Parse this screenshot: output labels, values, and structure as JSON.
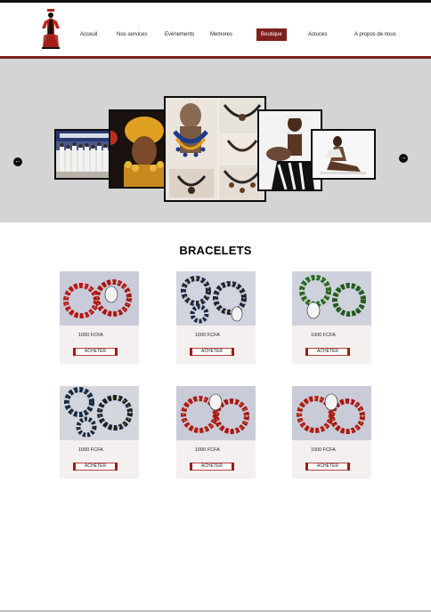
{
  "nav": {
    "items": [
      {
        "label": "Acceuil"
      },
      {
        "label": "Nos services"
      },
      {
        "label": "Evènements"
      },
      {
        "label": "Memores"
      },
      {
        "label": "Boutique",
        "active": true
      },
      {
        "label": "Astuces"
      },
      {
        "label": "A propos de nous"
      }
    ]
  },
  "hero": {
    "prev_icon": "arrow-left-icon",
    "next_icon": "arrow-right-icon"
  },
  "section": {
    "title": "BRACELETS"
  },
  "products": [
    {
      "price": "1000 FCFA",
      "buy_label": "ACHETER",
      "variant": "red-gold"
    },
    {
      "price": "1000 FCFA",
      "buy_label": "ACHETER",
      "variant": "navy-gold"
    },
    {
      "price": "1000 FCFA",
      "buy_label": "ACHETER",
      "variant": "green-gold"
    },
    {
      "price": "1000 FCFA",
      "buy_label": "ACHETER",
      "variant": "black-blue"
    },
    {
      "price": "1000 FCFA",
      "buy_label": "ACHETER",
      "variant": "red-gold"
    },
    {
      "price": "1000 FCFA",
      "buy_label": "ACHETER",
      "variant": "red-gold"
    }
  ],
  "colors": {
    "brand_red": "#7e1f1b",
    "hero_bg": "#d4d4d4",
    "card_bg": "#f5f0f0"
  }
}
